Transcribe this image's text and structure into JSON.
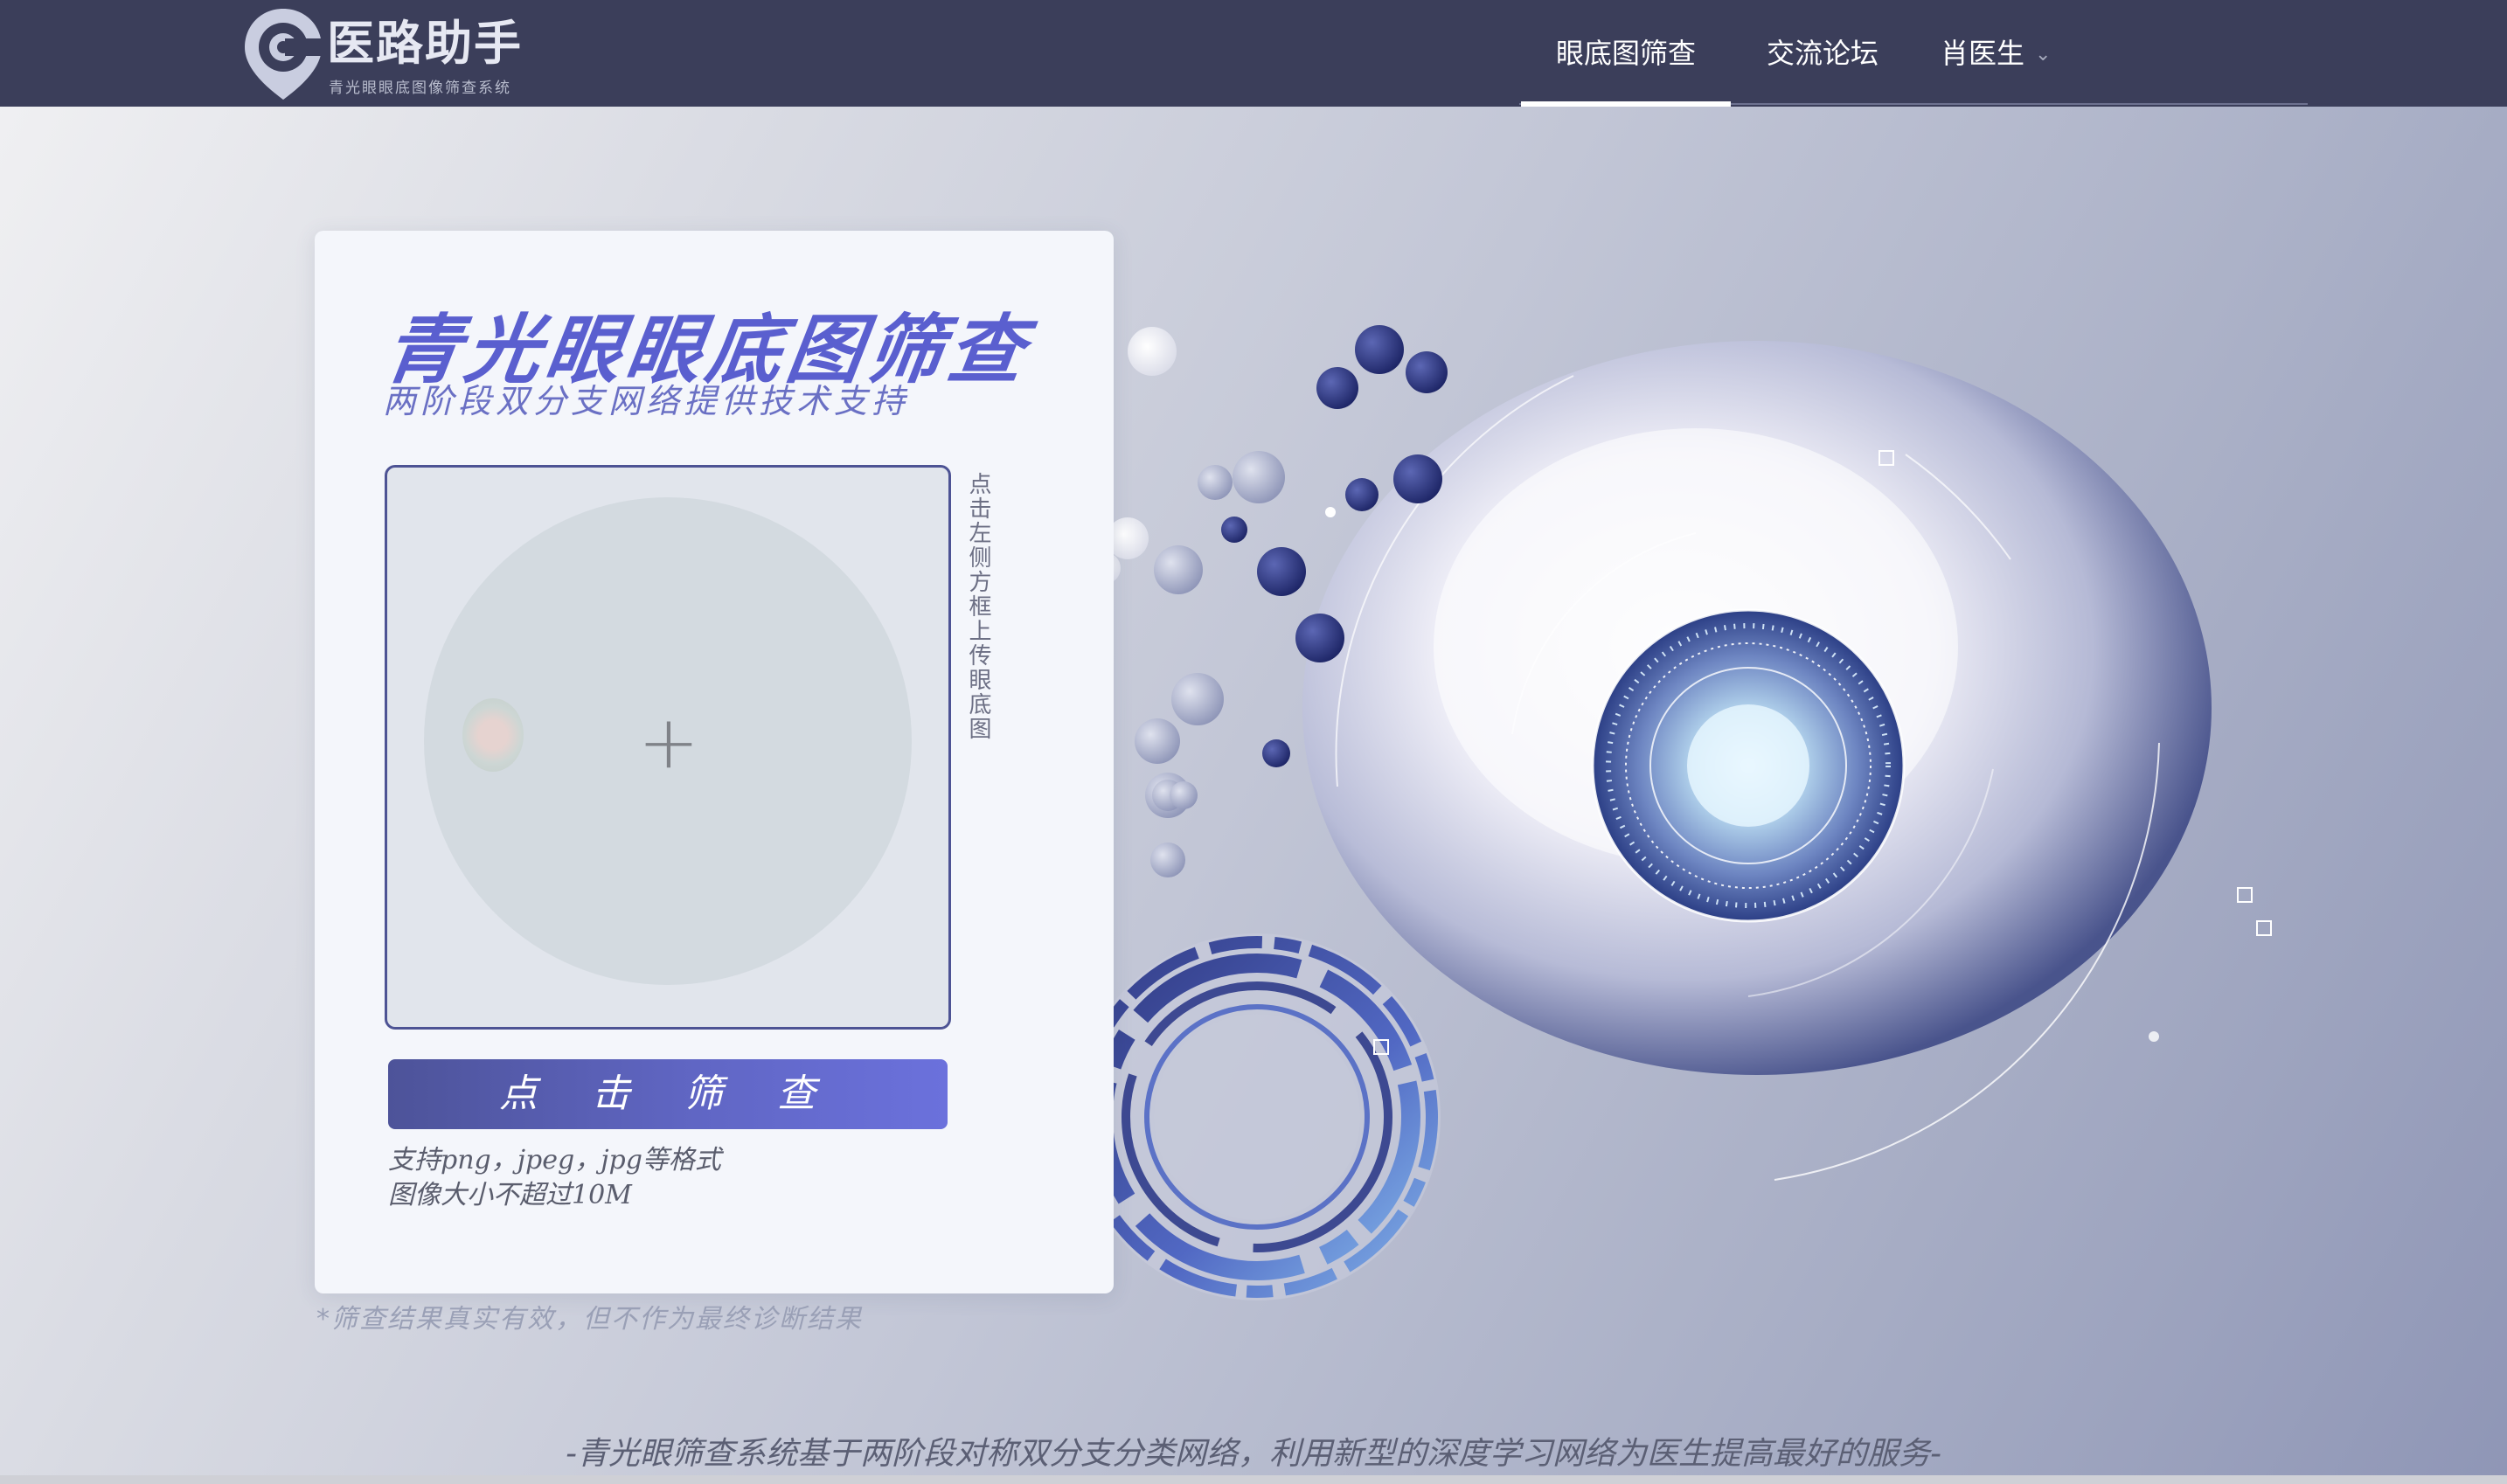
{
  "header": {
    "logo": {
      "title": "医路助手",
      "subtitle": "青光眼眼底图像筛查系统"
    },
    "nav": [
      {
        "label": "眼底图筛查",
        "active": true
      },
      {
        "label": "交流论坛",
        "active": false
      },
      {
        "label": "肖医生",
        "active": false,
        "has_dropdown": true
      }
    ]
  },
  "card": {
    "title": "青光眼眼底图筛查",
    "subtitle": "两阶段双分支网络提供技术支持",
    "upload_hint": "点击左侧方框上传眼底图",
    "screen_button": "点 击 筛 查",
    "format_line1": "支持png，jpeg，jpg等格式",
    "format_line2": "图像大小不超过10M"
  },
  "disclaimer": "*筛查结果真实有效，但不作为最终诊断结果",
  "footer": "-青光眼筛查系统基于两阶段对称双分支分类网络，利用新型的深度学习网络为医生提高最好的服务-",
  "colors": {
    "nav_bg": "#3b3e5a",
    "accent": "#5a5fcf",
    "button_start": "#4d5399",
    "button_end": "#6b71dc"
  },
  "icons": {
    "logo": "location-pin-c-icon",
    "dropdown": "chevron-down-icon",
    "upload": "plus-icon"
  }
}
